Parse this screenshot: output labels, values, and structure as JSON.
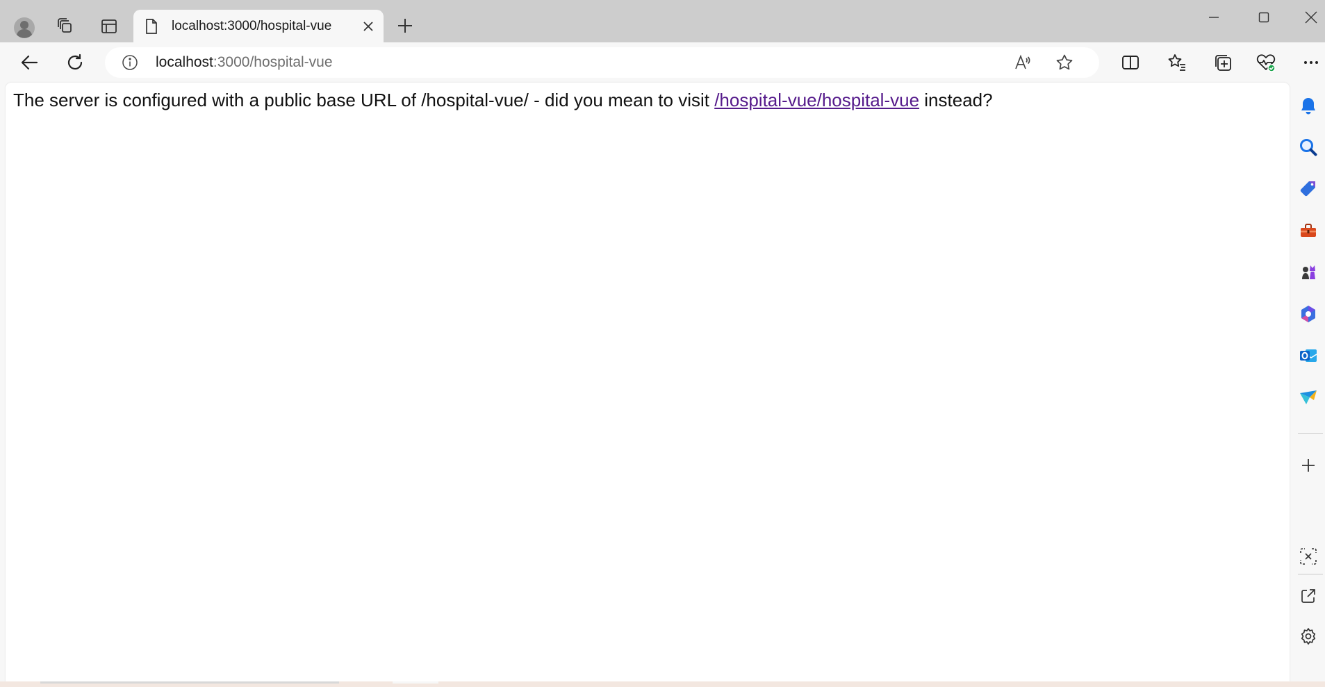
{
  "browser": {
    "tab": {
      "title": "localhost:3000/hospital-vue"
    },
    "address_bar": {
      "host": "localhost",
      "rest": ":3000/hospital-vue"
    },
    "colors": {
      "accent_blue": "#1a73e8",
      "link_visited": "#551a8b"
    }
  },
  "page": {
    "message_before": "The server is configured with a public base URL of /hospital-vue/ - did you mean to visit ",
    "link_text": "/hospital-vue/hospital-vue",
    "message_after": " instead?"
  },
  "icons": {
    "tabbar": [
      "profile-icon",
      "workspaces-icon",
      "vertical-tabs-icon",
      "page-icon",
      "close-icon",
      "new-tab-icon"
    ],
    "window": [
      "minimize-icon",
      "maximize-icon",
      "close-window-icon"
    ],
    "toolbar": [
      "back-icon",
      "refresh-icon",
      "info-icon",
      "read-aloud-icon",
      "favorite-star-icon",
      "split-screen-icon",
      "favorites-icon",
      "collections-icon",
      "browser-essentials-icon",
      "more-icon"
    ],
    "sidebar": [
      "bell-icon",
      "search-icon",
      "shopping-tag-icon",
      "tools-icon",
      "games-icon",
      "copilot-icon",
      "outlook-icon",
      "send-icon",
      "add-icon",
      "screenshot-icon",
      "open-external-icon",
      "settings-icon"
    ]
  }
}
